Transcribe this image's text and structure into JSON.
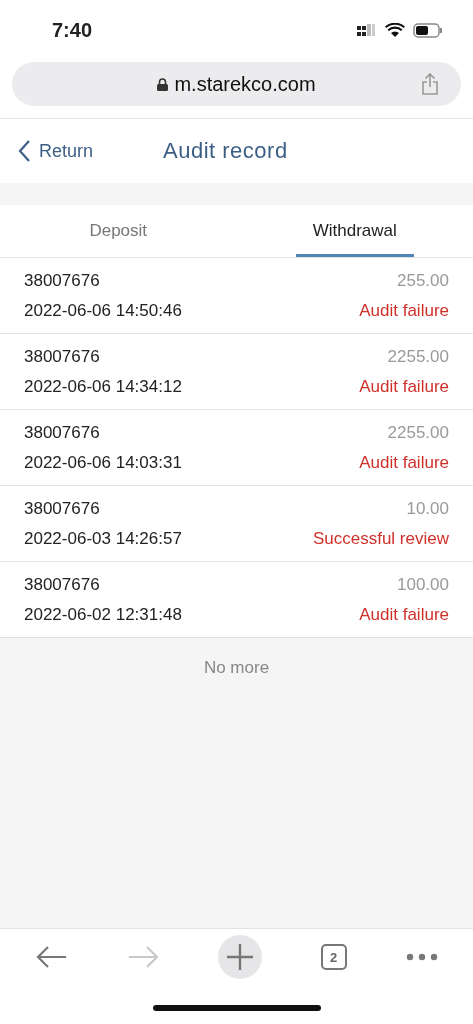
{
  "status_bar": {
    "time": "7:40"
  },
  "address_bar": {
    "url": "m.starekco.com"
  },
  "header": {
    "back": "Return",
    "title": "Audit record"
  },
  "tabs": [
    {
      "label": "Deposit",
      "selected": false
    },
    {
      "label": "Withdrawal",
      "selected": true
    }
  ],
  "records": [
    {
      "account": "38007676",
      "time": "2022-06-06 14:50:46",
      "amount": "255.00",
      "status": "Audit failure"
    },
    {
      "account": "38007676",
      "time": "2022-06-06 14:34:12",
      "amount": "2255.00",
      "status": "Audit failure"
    },
    {
      "account": "38007676",
      "time": "2022-06-06 14:03:31",
      "amount": "2255.00",
      "status": "Audit failure"
    },
    {
      "account": "38007676",
      "time": "2022-06-03 14:26:57",
      "amount": "10.00",
      "status": "Successful review"
    },
    {
      "account": "38007676",
      "time": "2022-06-02 12:31:48",
      "amount": "100.00",
      "status": "Audit failure"
    }
  ],
  "end_note": "No more",
  "toolbar": {
    "back_disabled": false,
    "forward_disabled": true,
    "tab_count": "2"
  }
}
